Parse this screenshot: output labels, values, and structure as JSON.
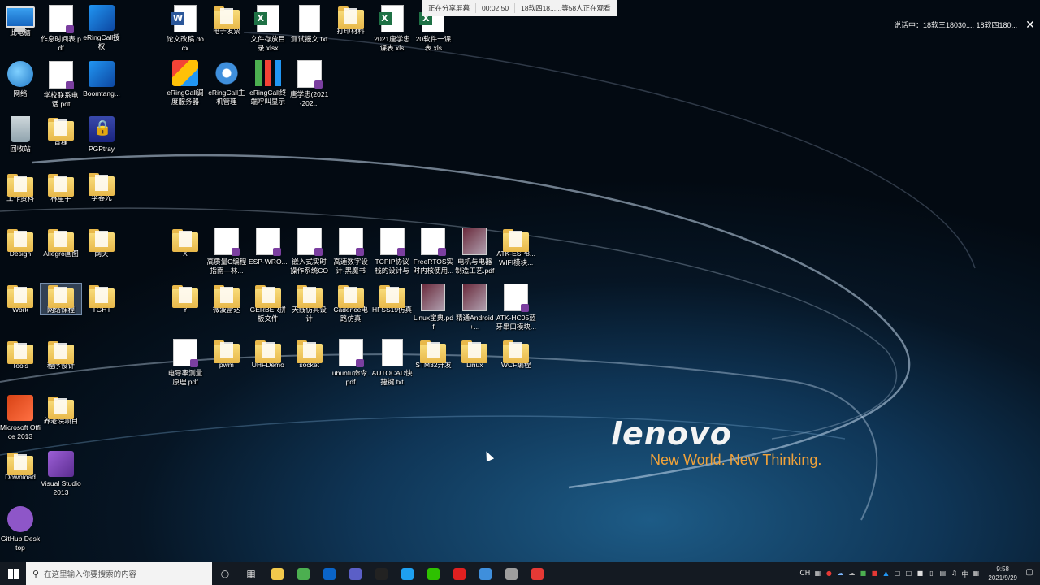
{
  "brand": {
    "logo": "lenovo",
    "tagline": "New World. New Thinking."
  },
  "share_bar": {
    "status": "正在分享屏幕",
    "timer": "00:02:50",
    "viewers": "18软四18......等58人正在观看"
  },
  "speaking": {
    "text": "说话中：18软三18030...; 18软四180...",
    "close": "✕"
  },
  "desktop": {
    "col1": [
      {
        "label": "此电脑",
        "icon": "computer-icon"
      },
      {
        "label": "网络",
        "icon": "network-icon"
      },
      {
        "label": "回收站",
        "icon": "recycle-bin-icon"
      },
      {
        "label": "工作资料",
        "icon": "folder-icon"
      },
      {
        "label": "Design",
        "icon": "folder-icon"
      },
      {
        "label": "Work",
        "icon": "folder-icon"
      },
      {
        "label": "Tools",
        "icon": "folder-icon"
      },
      {
        "label": "Microsoft Office 2013",
        "icon": "office-icon"
      },
      {
        "label": "Download",
        "icon": "folder-icon"
      },
      {
        "label": "GitHub Desktop",
        "icon": "github-icon"
      }
    ],
    "col2": [
      {
        "label": "作息时间表.pdf",
        "icon": "pdf-icon"
      },
      {
        "label": "学校联系电话.pdf",
        "icon": "pdf-icon"
      },
      {
        "label": "青稞",
        "icon": "folder-icon"
      },
      {
        "label": "林星宇",
        "icon": "folder-icon"
      },
      {
        "label": "Allegro画图",
        "icon": "folder-icon"
      },
      {
        "label": "网络课程",
        "icon": "folder-icon"
      },
      {
        "label": "程序设计",
        "icon": "folder-icon"
      },
      {
        "label": "养老院项目",
        "icon": "folder-icon"
      },
      {
        "label": "Visual Studio 2013",
        "icon": "visual-studio-icon"
      }
    ],
    "col3": [
      {
        "label": "eRingCall授权",
        "icon": "app-icon"
      },
      {
        "label": "Boomtang...",
        "icon": "app-icon"
      },
      {
        "label": "PGPtray",
        "icon": "lock-icon"
      },
      {
        "label": "李春光",
        "icon": "folder-icon"
      },
      {
        "label": "网关",
        "icon": "folder-icon"
      },
      {
        "label": "TGHT",
        "icon": "folder-icon"
      }
    ],
    "top_row1": [
      {
        "label": "论文改稿.docx",
        "icon": "word-icon"
      },
      {
        "label": "电子发票",
        "icon": "folder-icon"
      },
      {
        "label": "文件存放目录.xlsx",
        "icon": "excel-icon"
      },
      {
        "label": "测试报文.txt",
        "icon": "text-file-icon"
      },
      {
        "label": "打印材料",
        "icon": "folder-icon"
      },
      {
        "label": "2021唐学忠课表.xls",
        "icon": "excel-icon"
      },
      {
        "label": "20软件一课表.xls",
        "icon": "excel-icon"
      }
    ],
    "top_row2": [
      {
        "label": "eRingCall调度服务器",
        "icon": "blocks-icon"
      },
      {
        "label": "eRingCall主机管理",
        "icon": "gear-icon"
      },
      {
        "label": "eRingCall终端呼叫显示",
        "icon": "chart-icon"
      },
      {
        "label": "唐学忠(2021-202...",
        "icon": "pdf-icon"
      }
    ],
    "grid_row1": [
      {
        "label": "X",
        "icon": "folder-icon"
      },
      {
        "label": "高质量C编程指南—林...",
        "icon": "pdf-icon"
      },
      {
        "label": "ESP-WRO...",
        "icon": "pdf-icon"
      },
      {
        "label": "嵌入式实时操作系统COS...",
        "icon": "pdf-icon"
      },
      {
        "label": "高速数字设计-黑魔书（...",
        "icon": "pdf-icon"
      },
      {
        "label": "TCPIP协议栈的设计与实...",
        "icon": "pdf-icon"
      },
      {
        "label": "FreeRTOS实时内核使用...",
        "icon": "pdf-icon"
      },
      {
        "label": "电机与电器制造工艺.pdf",
        "icon": "book-icon"
      },
      {
        "label": "ATK-ESP8...WIFI模块...",
        "icon": "folder-icon"
      }
    ],
    "grid_row2": [
      {
        "label": "Y",
        "icon": "folder-icon"
      },
      {
        "label": "微波雷达",
        "icon": "folder-icon"
      },
      {
        "label": "GERBER拼板文件",
        "icon": "folder-icon"
      },
      {
        "label": "天线仿真设计",
        "icon": "folder-icon"
      },
      {
        "label": "Cadence电路仿真",
        "icon": "folder-icon"
      },
      {
        "label": "HFSS19仿真",
        "icon": "folder-icon"
      },
      {
        "label": "Linux宝典.pdf",
        "icon": "book-icon"
      },
      {
        "label": "精通Android+...",
        "icon": "book-icon"
      },
      {
        "label": "ATK-HC05蓝牙串口模块...",
        "icon": "pdf-icon"
      }
    ],
    "grid_row3": [
      {
        "label": "电导率测量原理.pdf",
        "icon": "pdf-icon"
      },
      {
        "label": "pwm",
        "icon": "folder-icon"
      },
      {
        "label": "UHFDemo",
        "icon": "folder-icon"
      },
      {
        "label": "socket",
        "icon": "folder-icon"
      },
      {
        "label": "ubuntu命令.pdf",
        "icon": "pdf-icon"
      },
      {
        "label": "AUTOCAD快捷键.txt",
        "icon": "text-file-icon"
      },
      {
        "label": "STM32开发",
        "icon": "folder-icon"
      },
      {
        "label": "Linux",
        "icon": "folder-icon"
      },
      {
        "label": "WCF编程",
        "icon": "folder-icon"
      }
    ]
  },
  "taskbar": {
    "search_placeholder": "在这里输入你要搜索的内容",
    "pinned": [
      {
        "name": "file-explorer",
        "color": "#f2c94c"
      },
      {
        "name": "chrome",
        "color": "#4caf50"
      },
      {
        "name": "outlook",
        "color": "#0a64c8"
      },
      {
        "name": "teams",
        "color": "#5b5fc7"
      },
      {
        "name": "qq",
        "color": "#222222"
      },
      {
        "name": "browser",
        "color": "#1ea0f0"
      },
      {
        "name": "wechat",
        "color": "#2ec100"
      },
      {
        "name": "netease-music",
        "color": "#e02020"
      },
      {
        "name": "app-blue",
        "color": "#3f8fdc"
      },
      {
        "name": "app-gray",
        "color": "#9e9e9e"
      },
      {
        "name": "app-red",
        "color": "#e53935"
      }
    ],
    "tray_ime": "CH",
    "tray_lang": "中",
    "time": "9:58",
    "date": "2021/9/29"
  }
}
